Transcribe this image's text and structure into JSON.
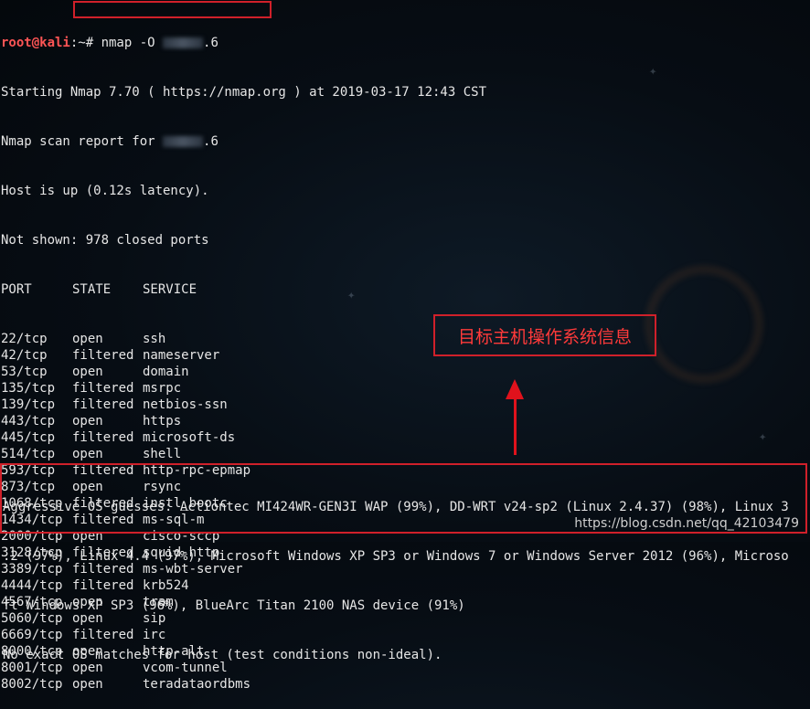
{
  "prompt": {
    "user": "root@kali",
    "path_symbol": ":~# ",
    "command_prefix": "nmap -O ",
    "command_suffix": ".6"
  },
  "header_lines": [
    "Starting Nmap 7.70 ( https://nmap.org ) at 2019-03-17 12:43 CST",
    "Host is up (0.12s latency).",
    "Not shown: 978 closed ports"
  ],
  "scan_report_prefix": "Nmap scan report for ",
  "scan_report_suffix": ".6",
  "columns": {
    "port": "PORT",
    "state": "STATE",
    "service": "SERVICE"
  },
  "ports": [
    [
      "22/tcp",
      "open",
      "ssh"
    ],
    [
      "42/tcp",
      "filtered",
      "nameserver"
    ],
    [
      "53/tcp",
      "open",
      "domain"
    ],
    [
      "135/tcp",
      "filtered",
      "msrpc"
    ],
    [
      "139/tcp",
      "filtered",
      "netbios-ssn"
    ],
    [
      "443/tcp",
      "open",
      "https"
    ],
    [
      "445/tcp",
      "filtered",
      "microsoft-ds"
    ],
    [
      "514/tcp",
      "open",
      "shell"
    ],
    [
      "593/tcp",
      "filtered",
      "http-rpc-epmap"
    ],
    [
      "873/tcp",
      "open",
      "rsync"
    ],
    [
      "1068/tcp",
      "filtered",
      "instl_bootc"
    ],
    [
      "1434/tcp",
      "filtered",
      "ms-sql-m"
    ],
    [
      "2000/tcp",
      "open",
      "cisco-sccp"
    ],
    [
      "3128/tcp",
      "filtered",
      "squid-http"
    ],
    [
      "3389/tcp",
      "filtered",
      "ms-wbt-server"
    ],
    [
      "4444/tcp",
      "filtered",
      "krb524"
    ],
    [
      "4567/tcp",
      "open",
      "tram"
    ],
    [
      "5060/tcp",
      "open",
      "sip"
    ],
    [
      "6669/tcp",
      "filtered",
      "irc"
    ],
    [
      "8000/tcp",
      "open",
      "http-alt"
    ],
    [
      "8001/tcp",
      "open",
      "vcom-tunnel"
    ],
    [
      "8002/tcp",
      "open",
      "teradataordbms"
    ]
  ],
  "os_lines": [
    "Aggressive OS guesses: Actiontec MI424WR-GEN3I WAP (99%), DD-WRT v24-sp2 (Linux 2.4.37) (98%), Linux 3",
    ".2 (97%), Linux 4.4 (97%), Microsoft Windows XP SP3 or Windows 7 or Windows Server 2012 (96%), Microso",
    "ft Windows XP SP3 (96%), BlueArc Titan 2100 NAS device (91%)",
    "No exact OS matches for host (test conditions non-ideal)."
  ],
  "callout_text": "目标主机操作系统信息",
  "watermark": "https://blog.csdn.net/qq_42103479",
  "colors": {
    "highlight": "#d0202a",
    "prompt_user": "#ff5555"
  }
}
